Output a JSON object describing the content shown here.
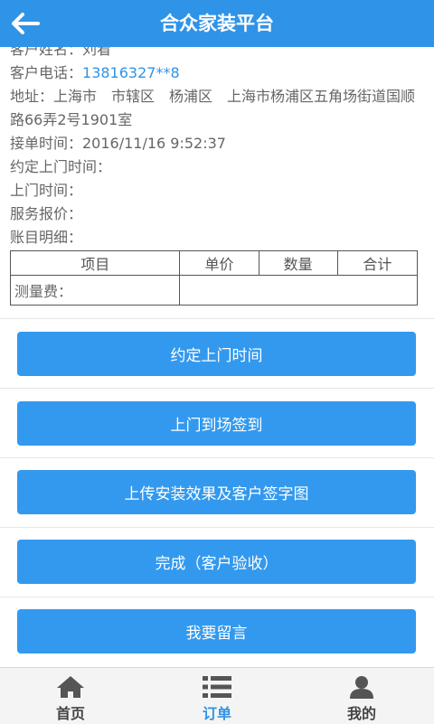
{
  "header": {
    "title": "合众家装平台"
  },
  "info": {
    "customer_name": "客户姓名：刘看",
    "phone_label": "客户电话：",
    "phone_value": "13816327**8",
    "address": "地址：上海市　市辖区　杨浦区　上海市杨浦区五角场街道国顺路66弄2号1901室",
    "accept_time": "接单时间：2016/11/16 9:52:37",
    "appointment_time": "约定上门时间：",
    "visit_time": "上门时间：",
    "service_quote": "服务报价：",
    "account_detail": "账目明细："
  },
  "table": {
    "headers": [
      "项目",
      "单价",
      "数量",
      "合计"
    ],
    "rows": [
      [
        "测量费：",
        "",
        "",
        ""
      ]
    ]
  },
  "actions": [
    {
      "label": "约定上门时间"
    },
    {
      "label": "上门到场签到"
    },
    {
      "label": "上传安装效果及客户签字图"
    },
    {
      "label": "完成（客户验收）"
    },
    {
      "label": "我要留言"
    }
  ],
  "tabs": [
    {
      "label": "首页",
      "icon": "home-icon"
    },
    {
      "label": "订单",
      "icon": "list-icon",
      "active": true
    },
    {
      "label": "我的",
      "icon": "user-icon"
    }
  ],
  "colors": {
    "brand": "#2f93e8",
    "button": "#3399ee"
  }
}
